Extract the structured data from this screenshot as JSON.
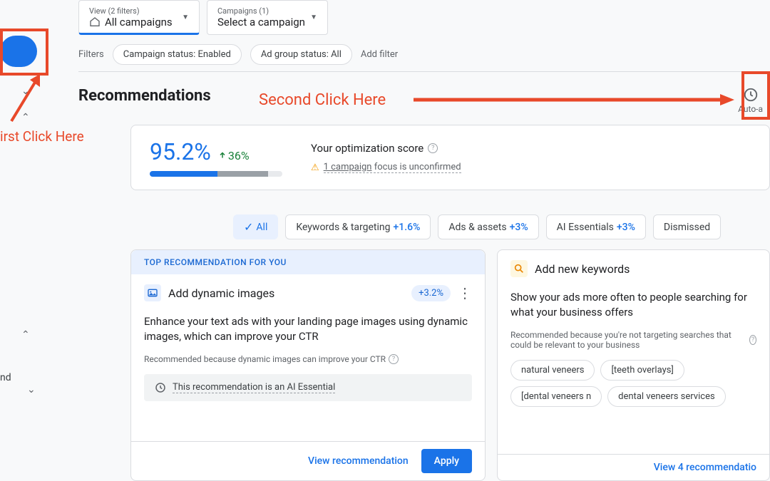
{
  "dropdown1": {
    "label": "View (2 filters)",
    "value": "All campaigns"
  },
  "dropdown2": {
    "label": "Campaigns (1)",
    "value": "Select a campaign"
  },
  "filters": {
    "label": "Filters",
    "chip1": "Campaign status: Enabled",
    "chip2": "Ad group status: All",
    "add": "Add filter"
  },
  "page_title": "Recommendations",
  "auto_apply": "Auto-a",
  "annotations": {
    "second": "Second Click Here",
    "first": "irst Click Here"
  },
  "side_text": "nd",
  "score": {
    "value": "95.2%",
    "delta": "36%",
    "title": "Your optimization score",
    "warning_link": "1 campaign",
    "warning_rest": " focus is unconfirmed"
  },
  "tabs": {
    "all": "All",
    "t1_label": "Keywords & targeting ",
    "t1_pct": "+1.6%",
    "t2_label": "Ads & assets ",
    "t2_pct": "+3%",
    "t3_label": "AI Essentials ",
    "t3_pct": "+3%",
    "t4_label": "Dismissed"
  },
  "card1": {
    "banner": "TOP RECOMMENDATION FOR YOU",
    "title": "Add dynamic images",
    "uplift": "+3.2%",
    "desc": "Enhance your text ads with your landing page images using dynamic images, which can improve your CTR",
    "sub": "Recommended because dynamic images can improve your CTR",
    "essential": "This recommendation is an AI Essential",
    "view": "View recommendation",
    "apply": "Apply"
  },
  "card2": {
    "title": "Add new keywords",
    "desc": "Show your ads more often to people searching for what your business offers",
    "sub": "Recommended because you're not targeting searches that could be relevant to your business",
    "kw1": "natural veneers",
    "kw2": "[teeth overlays]",
    "kw3": "[dental veneers n",
    "kw4": "dental veneers services",
    "view": "View 4 recommendatio"
  }
}
